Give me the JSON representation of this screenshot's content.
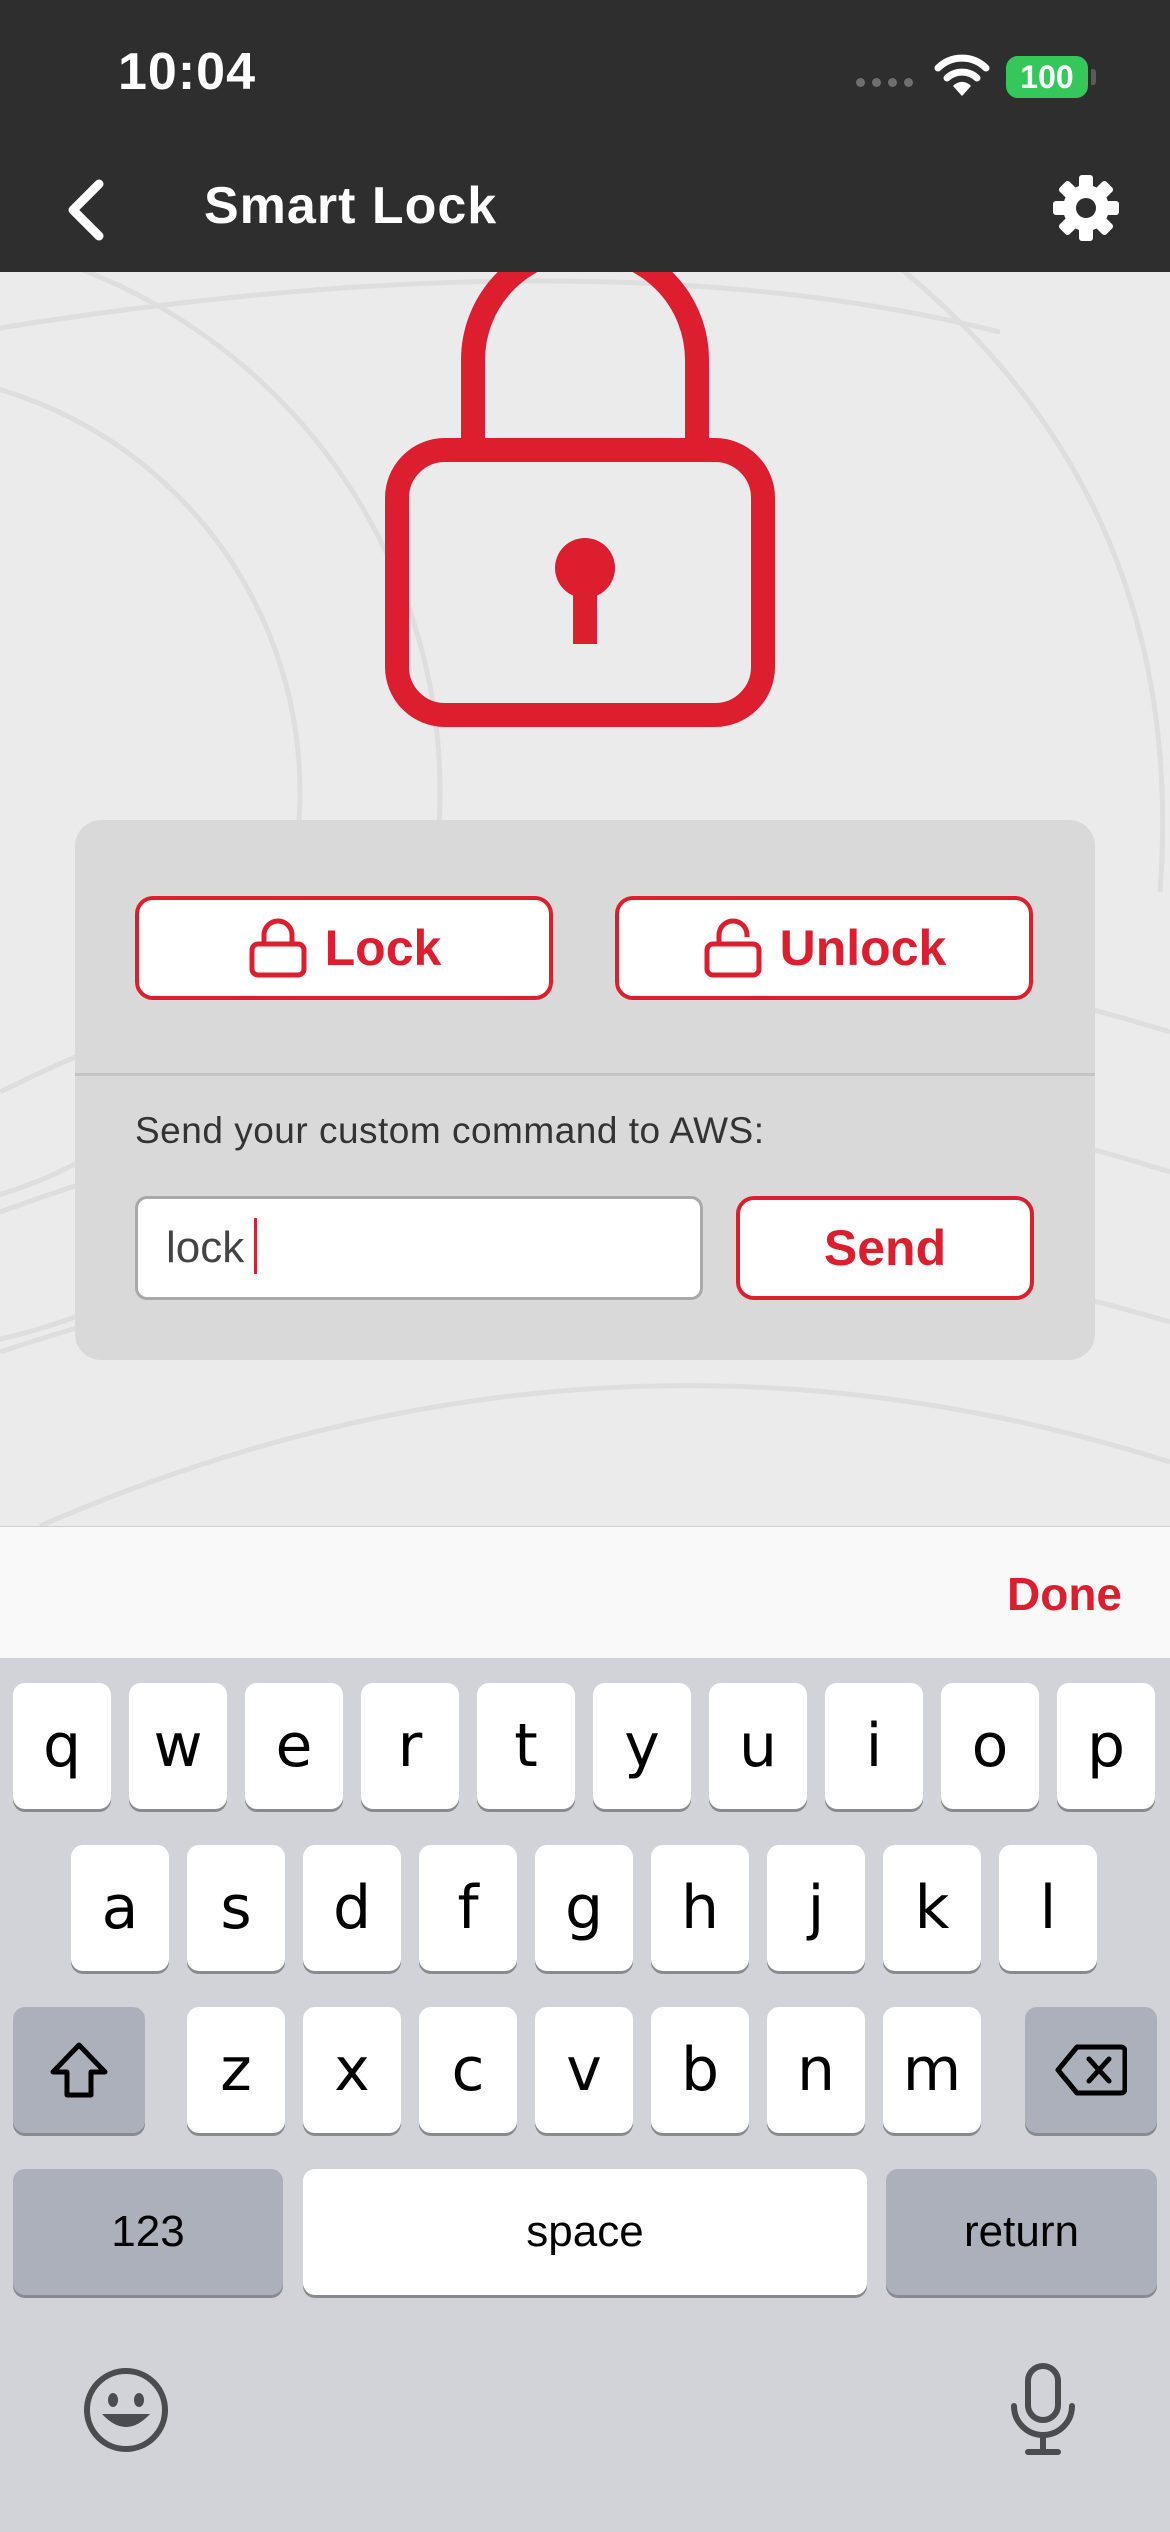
{
  "status_bar": {
    "time": "10:04",
    "battery": "100"
  },
  "nav": {
    "title": "Smart Lock",
    "back_icon": "chevron-left-icon",
    "settings_icon": "gear-icon"
  },
  "hero": {
    "icon": "padlock-icon"
  },
  "card": {
    "lock_label": "Lock",
    "unlock_label": "Unlock",
    "command_label": "Send your custom command to AWS:",
    "command_value": "lock",
    "send_label": "Send"
  },
  "keyboard": {
    "done_label": "Done",
    "row1": [
      "q",
      "w",
      "e",
      "r",
      "t",
      "y",
      "u",
      "i",
      "o",
      "p"
    ],
    "row2": [
      "a",
      "s",
      "d",
      "f",
      "g",
      "h",
      "j",
      "k",
      "l"
    ],
    "row3": [
      "z",
      "x",
      "c",
      "v",
      "b",
      "n",
      "m"
    ],
    "numbers_label": "123",
    "space_label": "space",
    "return_label": "return"
  },
  "colors": {
    "accent": "#dc1e2f",
    "header": "#2e2e2e",
    "background": "#ebebeb",
    "card": "#d9d9d9",
    "battery": "#34c759"
  }
}
